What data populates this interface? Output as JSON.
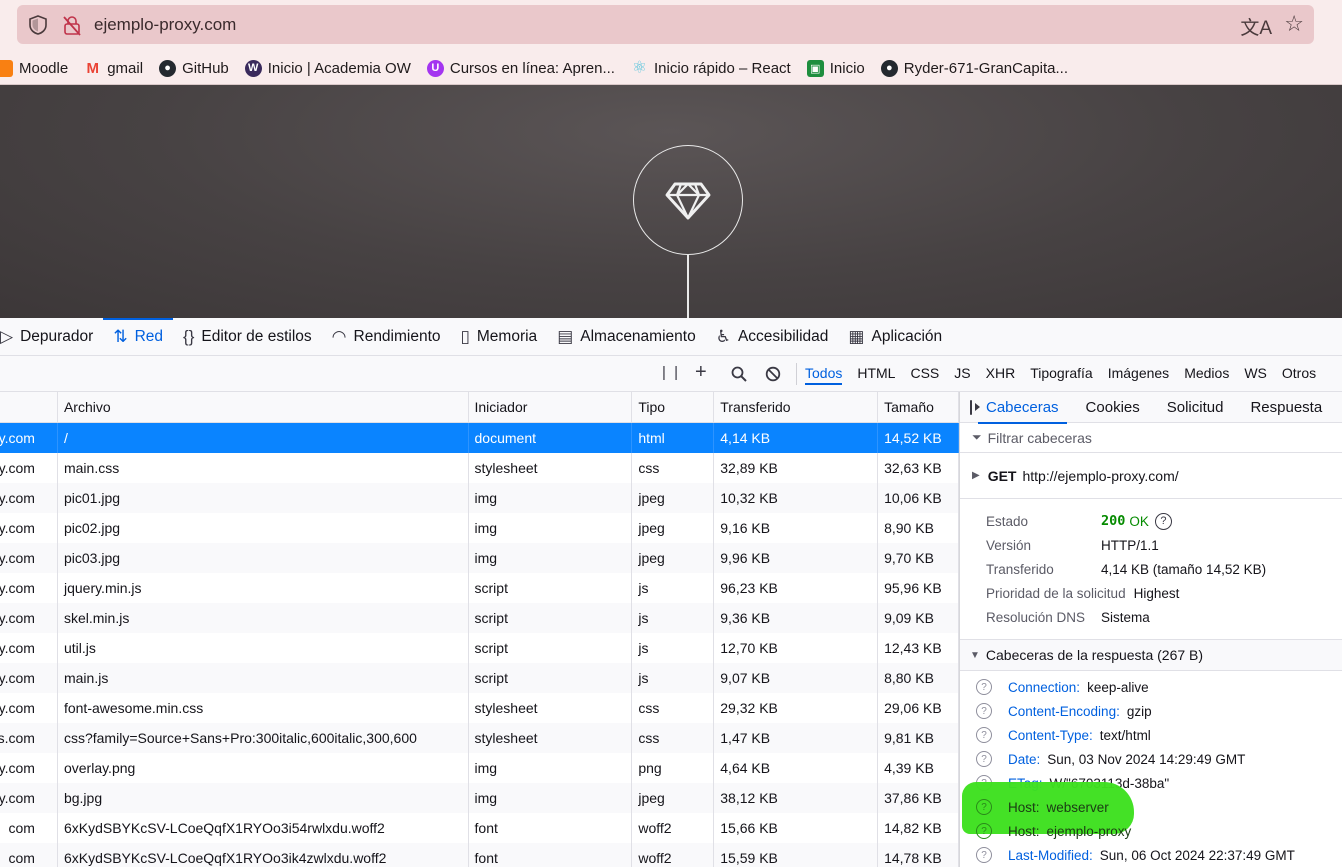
{
  "browser": {
    "url": "ejemplo-proxy.com",
    "bookmarks": [
      {
        "label": "Moodle",
        "icon": "moodle-icon",
        "color": "#f98012",
        "glyph": ""
      },
      {
        "label": "gmail",
        "icon": "gmail-icon",
        "color": "#ea4335",
        "glyph": "M"
      },
      {
        "label": "GitHub",
        "icon": "github-icon",
        "color": "#24292f",
        "glyph": "●"
      },
      {
        "label": "Inicio | Academia OW",
        "icon": "academia-ow-icon",
        "color": "#3a2a5c",
        "glyph": "W"
      },
      {
        "label": "Cursos en línea: Apren...",
        "icon": "udemy-icon",
        "color": "#a435f0",
        "glyph": "U"
      },
      {
        "label": "Inicio rápido – React",
        "icon": "react-icon",
        "color": "#58c4dc",
        "glyph": "⚛"
      },
      {
        "label": "Inicio",
        "icon": "classroom-icon",
        "color": "#1e8e3e",
        "glyph": "▣"
      },
      {
        "label": "Ryder-671-GranCapita...",
        "icon": "github-icon",
        "color": "#24292f",
        "glyph": "●"
      }
    ]
  },
  "devtools": {
    "tabs": [
      {
        "label": "Depurador",
        "icon": "debugger-icon",
        "glyph": "▷"
      },
      {
        "label": "Red",
        "icon": "network-icon",
        "glyph": "⇅"
      },
      {
        "label": "Editor de estilos",
        "icon": "style-editor-icon",
        "glyph": "{}"
      },
      {
        "label": "Rendimiento",
        "icon": "performance-icon",
        "glyph": "◠"
      },
      {
        "label": "Memoria",
        "icon": "memory-icon",
        "glyph": "▯"
      },
      {
        "label": "Almacenamiento",
        "icon": "storage-icon",
        "glyph": "▤"
      },
      {
        "label": "Accesibilidad",
        "icon": "accessibility-icon",
        "glyph": "♿"
      },
      {
        "label": "Aplicación",
        "icon": "application-icon",
        "glyph": "▦"
      }
    ],
    "active_tab": "Red",
    "filters": [
      "Todos",
      "HTML",
      "CSS",
      "JS",
      "XHR",
      "Tipografía",
      "Imágenes",
      "Medios",
      "WS",
      "Otros"
    ],
    "active_filter": "Todos"
  },
  "table": {
    "columns": [
      "Archivo",
      "Iniciador",
      "Tipo",
      "Transferido",
      "Tamaño"
    ],
    "rows": [
      {
        "domain": "y.com",
        "file": "/",
        "initiator": "document",
        "type": "html",
        "transferred": "4,14 KB",
        "size": "14,52 KB",
        "selected": true
      },
      {
        "domain": "y.com",
        "file": "main.css",
        "initiator": "stylesheet",
        "type": "css",
        "transferred": "32,89 KB",
        "size": "32,63 KB"
      },
      {
        "domain": "y.com",
        "file": "pic01.jpg",
        "initiator": "img",
        "type": "jpeg",
        "transferred": "10,32 KB",
        "size": "10,06 KB"
      },
      {
        "domain": "y.com",
        "file": "pic02.jpg",
        "initiator": "img",
        "type": "jpeg",
        "transferred": "9,16 KB",
        "size": "8,90 KB"
      },
      {
        "domain": "y.com",
        "file": "pic03.jpg",
        "initiator": "img",
        "type": "jpeg",
        "transferred": "9,96 KB",
        "size": "9,70 KB"
      },
      {
        "domain": "y.com",
        "file": "jquery.min.js",
        "initiator": "script",
        "type": "js",
        "transferred": "96,23 KB",
        "size": "95,96 KB"
      },
      {
        "domain": "y.com",
        "file": "skel.min.js",
        "initiator": "script",
        "type": "js",
        "transferred": "9,36 KB",
        "size": "9,09 KB"
      },
      {
        "domain": "y.com",
        "file": "util.js",
        "initiator": "script",
        "type": "js",
        "transferred": "12,70 KB",
        "size": "12,43 KB"
      },
      {
        "domain": "y.com",
        "file": "main.js",
        "initiator": "script",
        "type": "js",
        "transferred": "9,07 KB",
        "size": "8,80 KB"
      },
      {
        "domain": "y.com",
        "file": "font-awesome.min.css",
        "initiator": "stylesheet",
        "type": "css",
        "transferred": "29,32 KB",
        "size": "29,06 KB"
      },
      {
        "domain": "pis.com",
        "file": "css?family=Source+Sans+Pro:300italic,600italic,300,600",
        "initiator": "stylesheet",
        "type": "css",
        "transferred": "1,47 KB",
        "size": "9,81 KB"
      },
      {
        "domain": "y.com",
        "file": "overlay.png",
        "initiator": "img",
        "type": "png",
        "transferred": "4,64 KB",
        "size": "4,39 KB"
      },
      {
        "domain": "y.com",
        "file": "bg.jpg",
        "initiator": "img",
        "type": "jpeg",
        "transferred": "38,12 KB",
        "size": "37,86 KB"
      },
      {
        "domain": "com",
        "file": "6xKydSBYKcSV-LCoeQqfX1RYOo3i54rwlxdu.woff2",
        "initiator": "font",
        "type": "woff2",
        "transferred": "15,66 KB",
        "size": "14,82 KB"
      },
      {
        "domain": "com",
        "file": "6xKydSBYKcSV-LCoeQqfX1RYOo3ik4zwlxdu.woff2",
        "initiator": "font",
        "type": "woff2",
        "transferred": "15,59 KB",
        "size": "14,78 KB"
      }
    ]
  },
  "details": {
    "tabs": [
      "Cabeceras",
      "Cookies",
      "Solicitud",
      "Respuesta"
    ],
    "active_tab": "Cabeceras",
    "filter_placeholder": "Filtrar cabeceras",
    "method": "GET",
    "request_url": "http://ejemplo-proxy.com/",
    "summary": {
      "estado_label": "Estado",
      "status_code": "200",
      "status_text": "OK",
      "version_label": "Versión",
      "version": "HTTP/1.1",
      "transferred_label": "Transferido",
      "transferred": "4,14 KB (tamaño 14,52 KB)",
      "priority_label": "Prioridad de la solicitud",
      "priority": "Highest",
      "dns_label": "Resolución DNS",
      "dns": "Sistema"
    },
    "response_headers_title": "Cabeceras de la respuesta (267 B)",
    "response_headers": [
      {
        "name": "Connection:",
        "value": "keep-alive"
      },
      {
        "name": "Content-Encoding:",
        "value": "gzip"
      },
      {
        "name": "Content-Type:",
        "value": "text/html"
      },
      {
        "name": "Date:",
        "value": "Sun, 03 Nov 2024 14:29:49 GMT"
      },
      {
        "name": "ETag:",
        "value": "W/\"6703113d-38ba\""
      },
      {
        "name": "Host:",
        "value": "webserver",
        "highlight": true
      },
      {
        "name": "Host:",
        "value": "ejemplo-proxy",
        "highlight": true
      },
      {
        "name": "Last-Modified:",
        "value": "Sun, 06 Oct 2024 22:37:49 GMT"
      }
    ]
  },
  "colors": {
    "accent": "#0060df",
    "selected_row": "#0a84ff",
    "status_ok": "#058b00",
    "highlight": "#3ee01f"
  }
}
